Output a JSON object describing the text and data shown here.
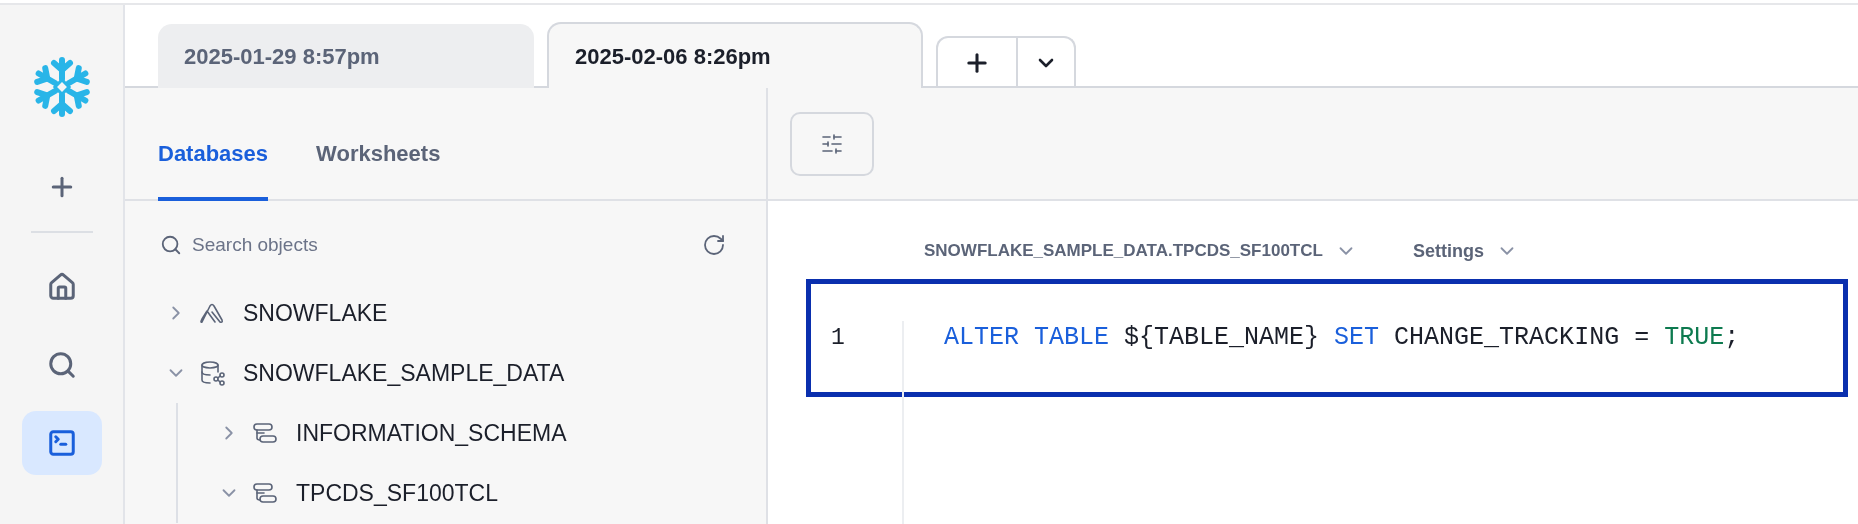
{
  "rail": {
    "items": [
      {
        "kind": "new",
        "selected": false
      },
      {
        "kind": "home",
        "selected": false
      },
      {
        "kind": "search",
        "selected": false
      },
      {
        "kind": "worksheets",
        "selected": true
      }
    ]
  },
  "worksheet_tabs": [
    {
      "label": "2025-01-29 8:57pm",
      "selected": false
    },
    {
      "label": "2025-02-06 8:26pm",
      "selected": true
    }
  ],
  "panel_tabs": [
    {
      "label": "Databases",
      "selected": true
    },
    {
      "label": "Worksheets",
      "selected": false
    }
  ],
  "search": {
    "placeholder": "Search objects"
  },
  "tree": [
    {
      "label": "SNOWFLAKE",
      "kind": "app",
      "expanded": false
    },
    {
      "label": "SNOWFLAKE_SAMPLE_DATA",
      "kind": "database",
      "expanded": true,
      "children": [
        {
          "label": "INFORMATION_SCHEMA",
          "kind": "schema",
          "expanded": false
        },
        {
          "label": "TPCDS_SF100TCL",
          "kind": "schema",
          "expanded": true
        }
      ]
    }
  ],
  "editor": {
    "context": "SNOWFLAKE_SAMPLE_DATA.TPCDS_SF100TCL",
    "settings": "Settings",
    "lines": [
      {
        "number": "1",
        "highlighted": true,
        "tokens": [
          {
            "text": "ALTER TABLE",
            "kind": "keyword"
          },
          {
            "text": " ${TABLE_NAME} ",
            "kind": "plain"
          },
          {
            "text": "SET",
            "kind": "keyword"
          },
          {
            "text": " CHANGE_TRACKING = ",
            "kind": "plain"
          },
          {
            "text": "TRUE",
            "kind": "literal"
          },
          {
            "text": ";",
            "kind": "plain"
          }
        ]
      }
    ]
  }
}
